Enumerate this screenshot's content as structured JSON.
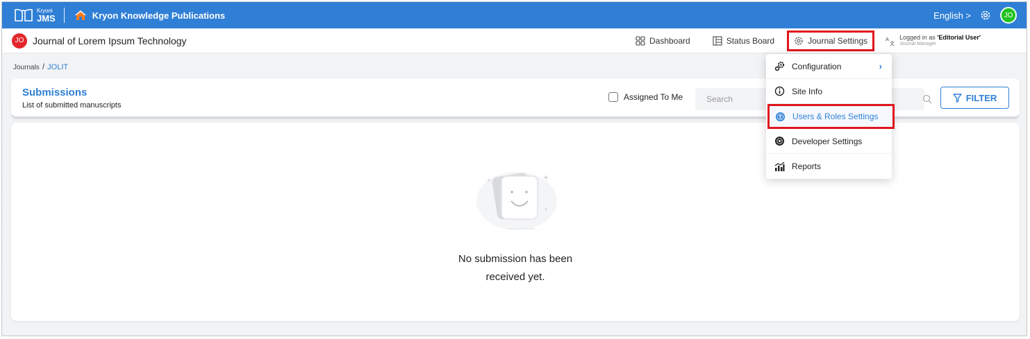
{
  "topbar": {
    "logo_small": "Kryoni",
    "logo_big": "JMS",
    "publisher": "Kryon Knowledge Publications",
    "language": "English >",
    "avatar": "JO",
    "colors": {
      "bar": "#2f7fd6",
      "avatar": "#22c222"
    }
  },
  "journal": {
    "avatar": "JO",
    "title": "Journal of Lorem Ipsum Technology",
    "nav": {
      "dashboard": "Dashboard",
      "status_board": "Status Board",
      "journal_settings": "Journal Settings"
    },
    "user": {
      "logged_prefix": "Logged in as ",
      "name": "'Editorial User'",
      "role": "Journal Manager"
    }
  },
  "breadcrumb": {
    "root": "Journals",
    "sep": "/",
    "current": "JOLIT"
  },
  "submissions": {
    "title": "Submissions",
    "subtitle": "List of submitted manuscripts",
    "assigned_label": "Assigned To Me",
    "search_placeholder": "Search",
    "filter_label": "FILTER"
  },
  "empty_state": {
    "line1": "No submission has been",
    "line2": "received yet."
  },
  "settings_menu": {
    "items": [
      {
        "label": "Configuration",
        "icon": "configuration-icon",
        "has_submenu": true
      },
      {
        "label": "Site Info",
        "icon": "info-icon"
      },
      {
        "label": "Users & Roles Settings",
        "icon": "users-roles-icon",
        "highlighted": true
      },
      {
        "label": "Developer Settings",
        "icon": "developer-icon"
      },
      {
        "label": "Reports",
        "icon": "reports-icon"
      }
    ]
  }
}
